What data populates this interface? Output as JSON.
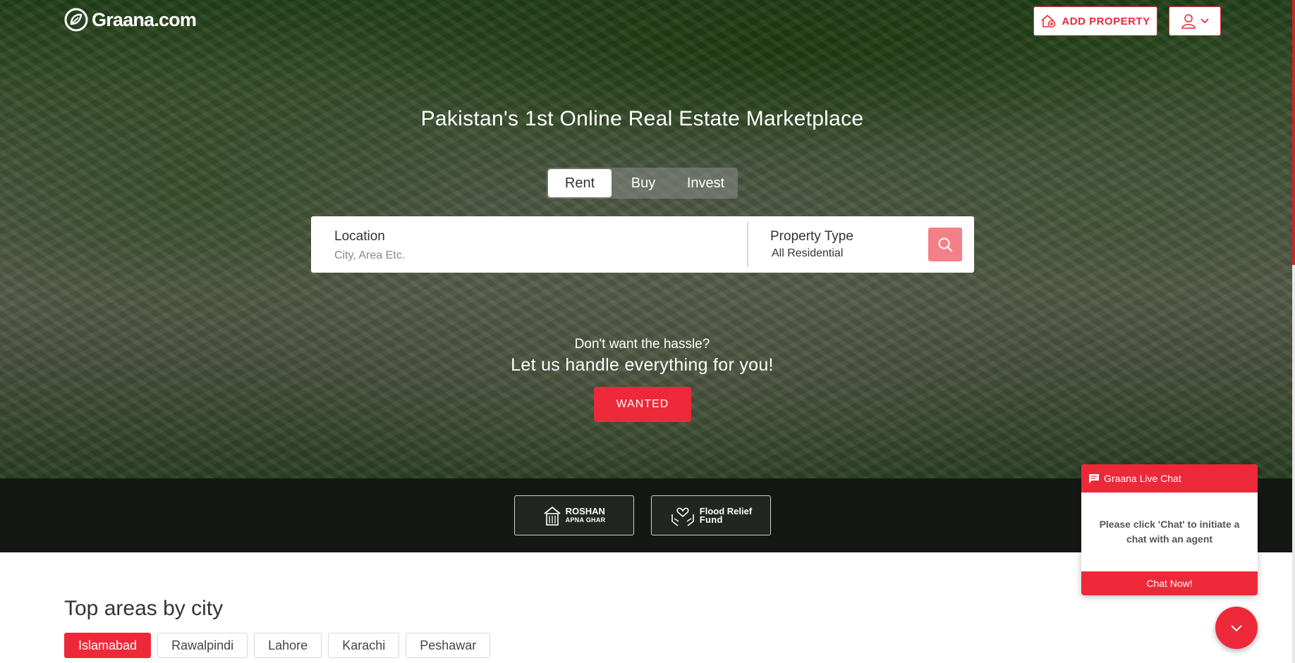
{
  "brand": {
    "name": "Graana.com",
    "accent": "#ed2939"
  },
  "header": {
    "add_property_label": "ADD PROPERTY",
    "add_property_icon": "house-plus-icon",
    "user_icon": "user-icon"
  },
  "hero": {
    "title": "Pakistan's 1st Online Real Estate Marketplace",
    "tabs": [
      {
        "label": "Rent",
        "active": true
      },
      {
        "label": "Buy",
        "active": false
      },
      {
        "label": "Invest",
        "active": false
      }
    ],
    "search": {
      "location_label": "Location",
      "location_placeholder": "City, Area Etc.",
      "property_type_label": "Property Type",
      "property_type_value": "All Residential"
    },
    "hassle_line1": "Don't want the hassle?",
    "hassle_line2": "Let us handle everything for you!",
    "wanted_label": "WANTED"
  },
  "partners": [
    {
      "line1": "ROSHAN",
      "line2": "APNA GHAR",
      "icon": "house-building-icon"
    },
    {
      "line1": "Flood Relief",
      "line2": "Fund",
      "icon": "hands-heart-icon"
    }
  ],
  "top_areas": {
    "title": "Top areas by city",
    "cities": [
      {
        "label": "Islamabad",
        "active": true
      },
      {
        "label": "Rawalpindi",
        "active": false
      },
      {
        "label": "Lahore",
        "active": false
      },
      {
        "label": "Karachi",
        "active": false
      },
      {
        "label": "Peshawar",
        "active": false
      }
    ]
  },
  "live_chat": {
    "title": "Graana Live Chat",
    "message": "Please click 'Chat' to initiate a chat with an agent",
    "button_label": "Chat Now!"
  }
}
